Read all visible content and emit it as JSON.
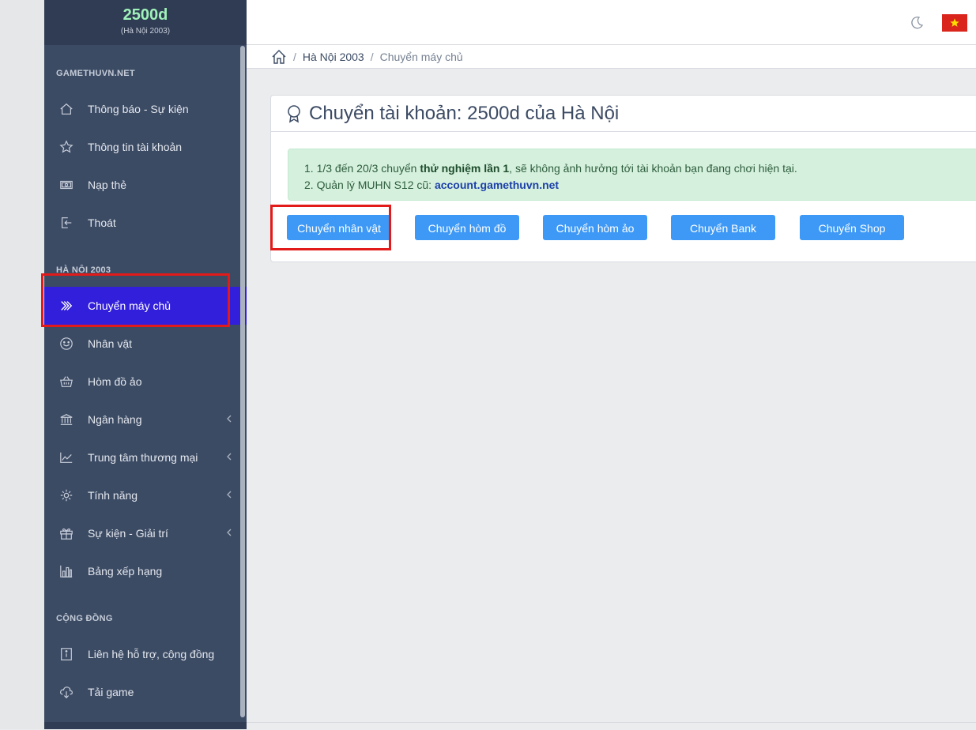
{
  "brand": {
    "name": "2500d",
    "sub": "(Hà Nội 2003)"
  },
  "sidebar": {
    "sections": [
      "GAMETHUVN.NET",
      "HÀ NỘI 2003",
      "CỘNG ĐỒNG"
    ],
    "items": [
      {
        "label": "Thông báo - Sự kiện",
        "icon": "home-icon"
      },
      {
        "label": "Thông tin tài khoản",
        "icon": "star-icon"
      },
      {
        "label": "Nạp thẻ",
        "icon": "money-icon"
      },
      {
        "label": "Thoát",
        "icon": "logout-icon"
      },
      {
        "label": "Chuyển máy chủ",
        "icon": "double-chevron-icon",
        "active": true
      },
      {
        "label": "Nhân vật",
        "icon": "smile-icon"
      },
      {
        "label": "Hòm đồ ảo",
        "icon": "basket-icon"
      },
      {
        "label": "Ngân hàng",
        "icon": "bank-icon",
        "has_submenu": true
      },
      {
        "label": "Trung tâm thương mại",
        "icon": "chart-line-icon",
        "has_submenu": true
      },
      {
        "label": "Tính năng",
        "icon": "settings-icon",
        "has_submenu": true
      },
      {
        "label": "Sự kiện - Giải trí",
        "icon": "gift-icon",
        "has_submenu": true
      },
      {
        "label": "Bảng xếp hạng",
        "icon": "bar-chart-icon"
      },
      {
        "label": "Liên hệ hỗ trợ, cộng đồng",
        "icon": "info-icon"
      },
      {
        "label": "Tải game",
        "icon": "cloud-download-icon"
      }
    ]
  },
  "breadcrumb": {
    "items": [
      "Hà Nội 2003",
      "Chuyển máy chủ"
    ]
  },
  "card": {
    "title": "Chuyển tài khoản: 2500d của Hà Nội",
    "notice": {
      "line1_prefix": "1. 1/3 đến 20/3 chuyển ",
      "line1_bold": "thử nghiệm lần 1",
      "line1_suffix": ", sẽ không ảnh hưởng tới tài khoản bạn đang chơi hiện tại.",
      "line2_prefix": "2. Quản lý MUHN S12 cũ: ",
      "line2_link": "account.gamethuvn.net"
    },
    "buttons": [
      "Chuyển nhân vật",
      "Chuyển hòm đồ",
      "Chuyển hòm ảo",
      "Chuyển Bank",
      "Chuyển Shop"
    ]
  },
  "colors": {
    "sidebar_bg": "#3c4b64",
    "active": "#321fdb",
    "button": "#3d99f5",
    "highlight": "#e21a1a"
  }
}
